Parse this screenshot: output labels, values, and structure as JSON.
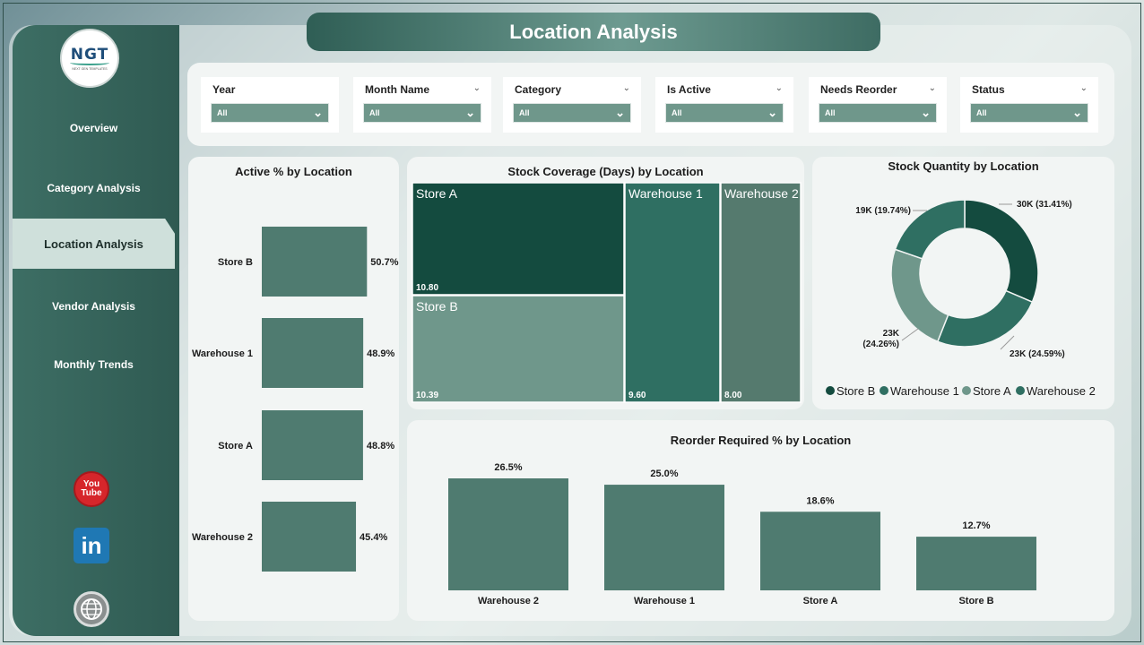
{
  "page_title": "Location Analysis",
  "logo": {
    "text": "NGT",
    "subtitle": "NEXT GEN TEMPLATES"
  },
  "nav": [
    {
      "label": "Overview",
      "active": false
    },
    {
      "label": "Category Analysis",
      "active": false
    },
    {
      "label": "Location Analysis",
      "active": true
    },
    {
      "label": "Vendor Analysis",
      "active": false
    },
    {
      "label": "Monthly Trends",
      "active": false
    }
  ],
  "social": {
    "youtube_line1": "You",
    "youtube_line2": "Tube",
    "linkedin": "in",
    "icons": [
      "youtube-icon",
      "linkedin-icon",
      "globe-icon"
    ]
  },
  "filters": [
    {
      "label": "Year",
      "value": "All",
      "has_header_chevron": false
    },
    {
      "label": "Month Name",
      "value": "All",
      "has_header_chevron": true
    },
    {
      "label": "Category",
      "value": "All",
      "has_header_chevron": true
    },
    {
      "label": "Is Active",
      "value": "All",
      "has_header_chevron": true
    },
    {
      "label": "Needs Reorder",
      "value": "All",
      "has_header_chevron": true
    },
    {
      "label": "Status",
      "value": "All",
      "has_header_chevron": true
    }
  ],
  "colors": {
    "primary": "#4f7b70",
    "dark": "#144b3f",
    "mid": "#2f6f62",
    "light": "#6f978b",
    "muted": "#557a6e"
  },
  "chart_data": [
    {
      "type": "bar",
      "orientation": "horizontal",
      "title": "Active % by Location",
      "categories": [
        "Store B",
        "Warehouse 1",
        "Store A",
        "Warehouse 2"
      ],
      "values": [
        50.7,
        48.9,
        48.8,
        45.4
      ],
      "labels": [
        "50.7%",
        "48.9%",
        "48.8%",
        "45.4%"
      ],
      "unit": "%"
    },
    {
      "type": "treemap",
      "title": "Stock Coverage (Days) by Location",
      "categories": [
        "Store A",
        "Store B",
        "Warehouse 1",
        "Warehouse 2"
      ],
      "values": [
        10.8,
        10.39,
        9.6,
        8.0
      ],
      "labels": [
        "10.80",
        "10.39",
        "9.60",
        "8.00"
      ]
    },
    {
      "type": "pie",
      "donut": true,
      "title": "Stock Quantity by Location",
      "categories": [
        "Store B",
        "Warehouse 1",
        "Store A",
        "Warehouse 2"
      ],
      "values": [
        31.41,
        24.59,
        24.26,
        19.74
      ],
      "labels": [
        "30K (31.41%)",
        "23K (24.59%)",
        "23K",
        "19K (19.74%)"
      ],
      "label_extra": [
        "",
        "",
        "(24.26%)",
        ""
      ],
      "legend": [
        "Store B",
        "Warehouse 1",
        "Store A",
        "Warehouse 2"
      ],
      "legend_position": "bottom"
    },
    {
      "type": "bar",
      "orientation": "vertical",
      "title": "Reorder Required % by Location",
      "categories": [
        "Warehouse 2",
        "Warehouse 1",
        "Store A",
        "Store B"
      ],
      "values": [
        26.5,
        25.0,
        18.6,
        12.7
      ],
      "labels": [
        "26.5%",
        "25.0%",
        "18.6%",
        "12.7%"
      ],
      "unit": "%"
    }
  ]
}
